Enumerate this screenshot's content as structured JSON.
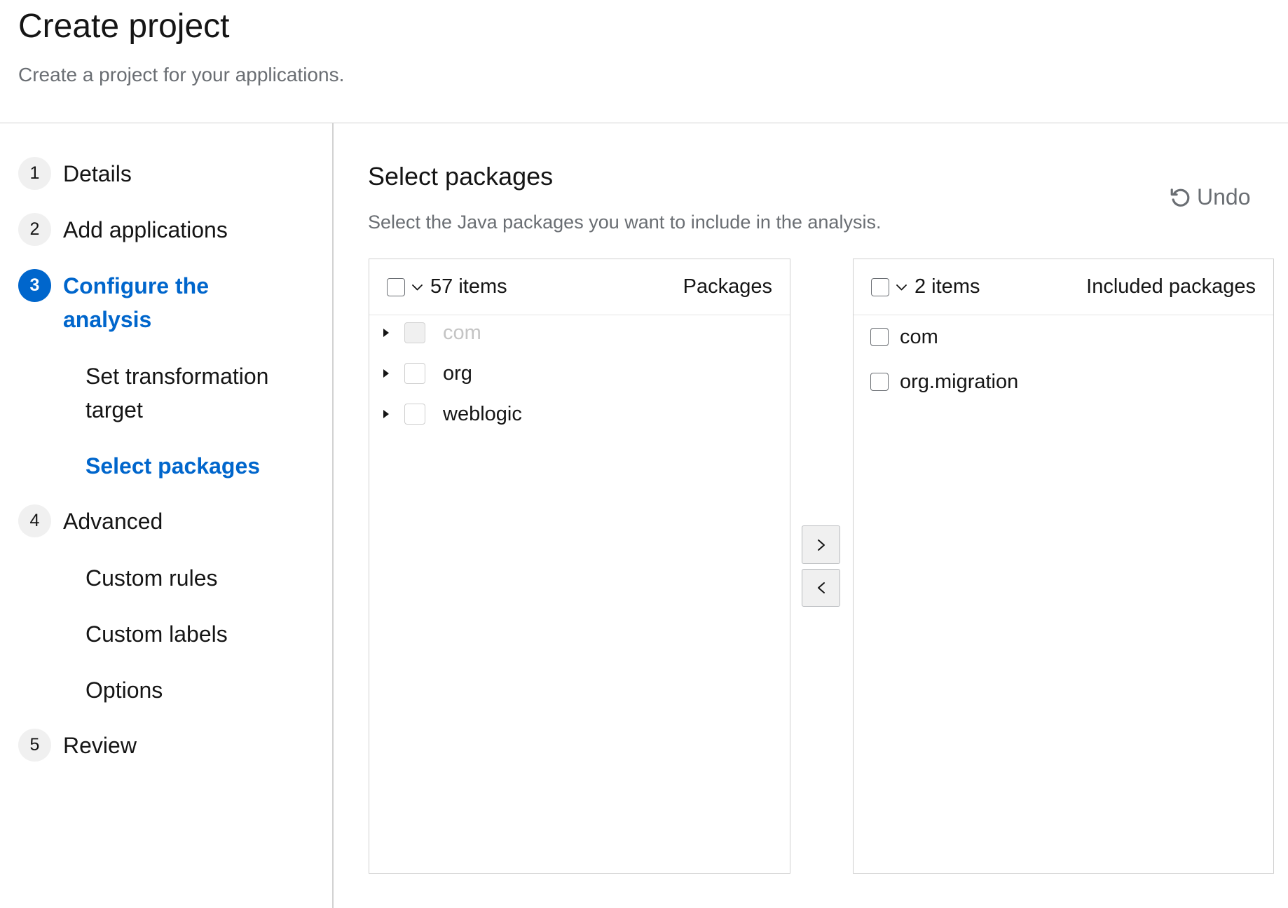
{
  "header": {
    "title": "Create project",
    "subtitle": "Create a project for your applications."
  },
  "nav": {
    "steps": [
      {
        "number": "1",
        "label": "Details",
        "current": false
      },
      {
        "number": "2",
        "label": "Add applications",
        "current": false
      },
      {
        "number": "3",
        "label": "Configure the analysis",
        "current": true,
        "substeps": [
          {
            "label": "Set transformation target",
            "current": false
          },
          {
            "label": "Select packages",
            "current": true
          }
        ]
      },
      {
        "number": "4",
        "label": "Advanced",
        "current": false,
        "substeps": [
          {
            "label": "Custom rules",
            "current": false
          },
          {
            "label": "Custom labels",
            "current": false
          },
          {
            "label": "Options",
            "current": false
          }
        ]
      },
      {
        "number": "5",
        "label": "Review",
        "current": false
      }
    ]
  },
  "main": {
    "title": "Select packages",
    "description": "Select the Java packages you want to include in the analysis.",
    "undo": {
      "label": "Undo",
      "icon": "undo-icon"
    },
    "available": {
      "select_all_checked": false,
      "count": "57 items",
      "title": "Packages",
      "items": [
        {
          "label": "com",
          "disabled": true,
          "checked": false,
          "expandable": true
        },
        {
          "label": "org",
          "disabled": false,
          "checked": false,
          "expandable": true
        },
        {
          "label": "weblogic",
          "disabled": false,
          "checked": false,
          "expandable": true
        }
      ]
    },
    "controls": {
      "add_icon": "angle-right-icon",
      "remove_icon": "angle-left-icon"
    },
    "chosen": {
      "select_all_checked": false,
      "count": "2 items",
      "title": "Included packages",
      "items": [
        {
          "label": "com",
          "checked": false
        },
        {
          "label": "org.migration",
          "checked": false
        }
      ]
    }
  },
  "theme": {
    "accent": "#0066cc",
    "text": "#151515",
    "muted": "#6a6e73",
    "border": "#d2d2d2",
    "badge_bg": "#f0f0f0"
  }
}
